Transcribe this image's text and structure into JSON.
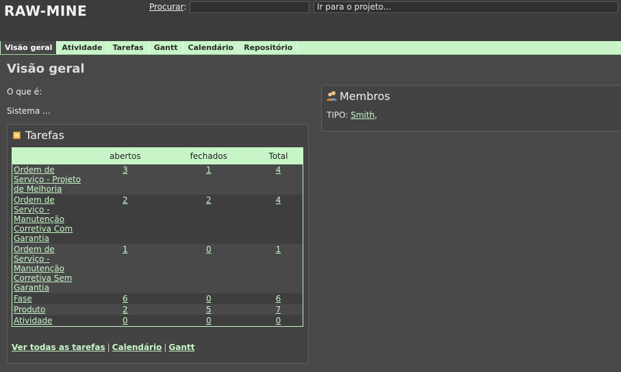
{
  "header": {
    "app_title": "RAW-MINE",
    "search_label": "Procurar",
    "search_colon": ":",
    "search_value": "",
    "jump_placeholder": "Ir para o projeto..."
  },
  "tabs": [
    {
      "label": "Visão geral",
      "selected": true
    },
    {
      "label": "Atividade",
      "selected": false
    },
    {
      "label": "Tarefas",
      "selected": false
    },
    {
      "label": "Gantt",
      "selected": false
    },
    {
      "label": "Calendário",
      "selected": false
    },
    {
      "label": "Repositório",
      "selected": false
    }
  ],
  "main": {
    "page_title": "Visão geral",
    "description_label": "O que é:",
    "description_value": "Sistema ..."
  },
  "issues": {
    "title": "Tarefas",
    "columns": [
      "",
      "abertos",
      "fechados",
      "Total"
    ],
    "rows": [
      {
        "name": "Ordem de Serviço - Projeto de Melhoria",
        "open": "3",
        "closed": "1",
        "total": "4"
      },
      {
        "name": "Ordem de Serviço - Manutenção Corretiva Com Garantia",
        "open": "2",
        "closed": "2",
        "total": "4"
      },
      {
        "name": "Ordem de Serviço - Manutenção Corretiva Sem Garantia",
        "open": "1",
        "closed": "0",
        "total": "1"
      },
      {
        "name": "Fase",
        "open": "6",
        "closed": "0",
        "total": "6"
      },
      {
        "name": "Produto",
        "open": "2",
        "closed": "5",
        "total": "7"
      },
      {
        "name": "Atividade",
        "open": "0",
        "closed": "0",
        "total": "0"
      }
    ],
    "links": {
      "view_all": "Ver todas as tarefas",
      "calendar": "Calendário",
      "gantt": "Gantt",
      "separator": "|"
    }
  },
  "members": {
    "title": "Membros",
    "role_label": "TIPO:",
    "member_name": "Smith",
    "trailing": ","
  },
  "colors": {
    "background": "#484848",
    "accent_green": "#c8f5c8",
    "box_background": "#434343"
  },
  "icons": {
    "issues": "feed-icon",
    "members": "group-icon"
  }
}
